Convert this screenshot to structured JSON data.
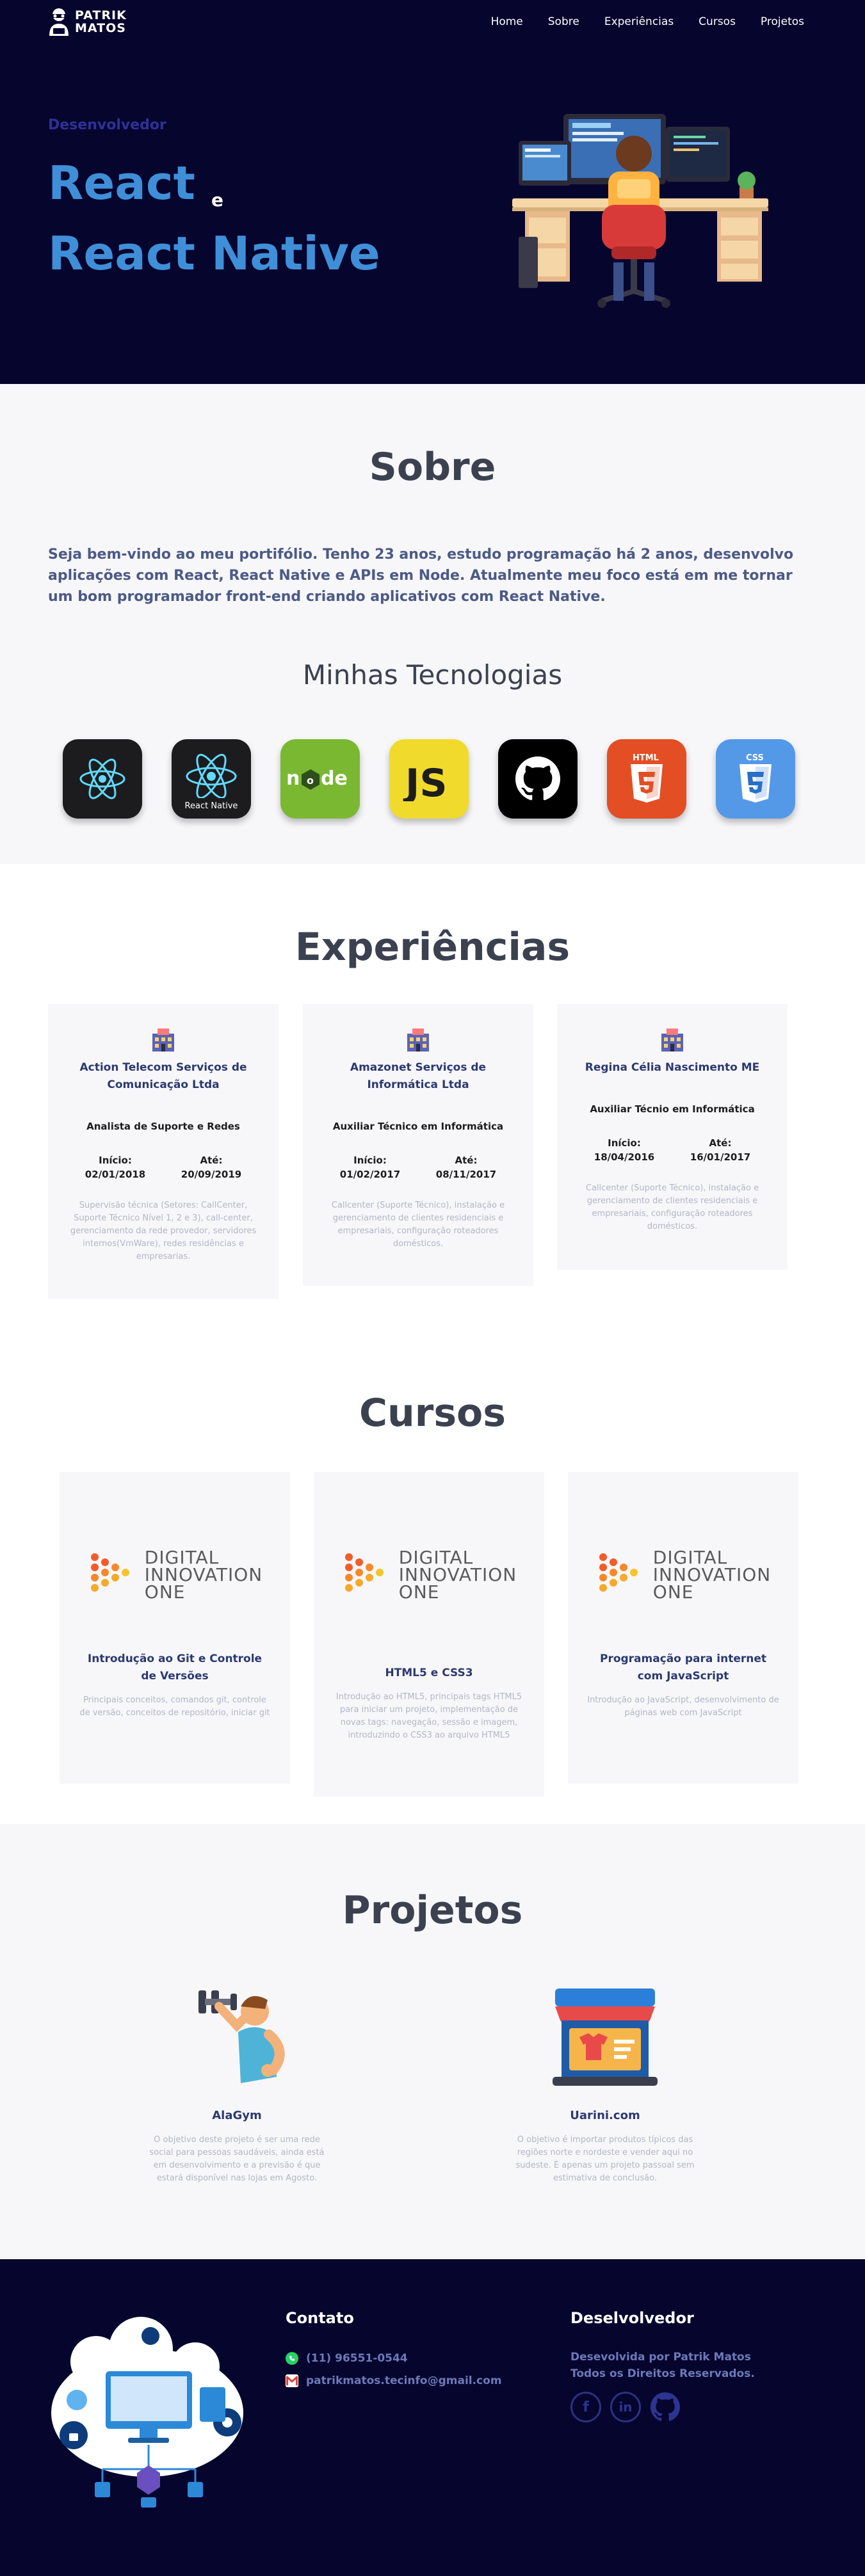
{
  "brand": {
    "line1": "PATRIK",
    "line2": "MATOS"
  },
  "nav": {
    "items": [
      "Home",
      "Sobre",
      "Experiências",
      "Cursos",
      "Projetos"
    ]
  },
  "hero": {
    "subtitle": "Desenvolvedor",
    "title1": "React",
    "connector": "e",
    "title2": "React Native"
  },
  "sobre": {
    "title": "Sobre",
    "text": "Seja bem-vindo ao meu portifólio. Tenho 23 anos, estudo programação há 2 anos, desenvolvo aplicações com React, React Native e APIs em Node. Atualmente meu foco está em me tornar um bom programador front-end criando aplicativos com React Native.",
    "tech_title": "Minhas Tecnologias",
    "techs": [
      {
        "icon": "react-icon",
        "label": "",
        "bg": "#1c1c1f"
      },
      {
        "icon": "react-native-icon",
        "label": "React Native",
        "bg": "#1c1c1f"
      },
      {
        "icon": "node-icon",
        "label": "",
        "bg": "#7ab832"
      },
      {
        "icon": "javascript-icon",
        "label": "",
        "bg": "#f0db2c"
      },
      {
        "icon": "github-icon",
        "label": "",
        "bg": "#000000"
      },
      {
        "icon": "html5-icon",
        "label": "HTML",
        "bg": "#e34e24"
      },
      {
        "icon": "css3-icon",
        "label": "CSS",
        "bg": "#5499e8"
      }
    ]
  },
  "experiencias": {
    "title": "Experiências",
    "start_label": "Início:",
    "end_label": "Até:",
    "items": [
      {
        "company": "Action Telecom Serviços de Comunicação Ltda",
        "role": "Analista de Suporte e Redes",
        "start": "02/01/2018",
        "end": "20/09/2019",
        "desc": "Supervisão técnica (Setores: CallCenter, Suporte Técnico Nível 1, 2 e 3), call-center, gerenciamento da rede provedor, servidores internos(VmWare), redes residências e empresarias."
      },
      {
        "company": "Amazonet Serviços de Informática Ltda",
        "role": "Auxiliar Técnico em Informática",
        "start": "01/02/2017",
        "end": "08/11/2017",
        "desc": "Callcenter (Suporte Técnico), instalação e gerenciamento de clientes residenciais e empresariais, configuração roteadores domésticos."
      },
      {
        "company": "Regina Célia Nascimento ME",
        "role": "Auxiliar Técnio em Informática",
        "start": "18/04/2016",
        "end": "16/01/2017",
        "desc": "Callcenter (Suporte Técnico), instalação e gerenciamento de clientes residenciais e empresariais, configuração roteadores domésticos."
      }
    ]
  },
  "cursos": {
    "title": "Cursos",
    "logo_lines": [
      "DIGITAL",
      "INNOVATION",
      "ONE"
    ],
    "items": [
      {
        "name": "Introdução ao Git e Controle de Versões",
        "desc": "Principais conceitos, comandos git, controle de versão, conceitos de repositório, iniciar git"
      },
      {
        "name": "HTML5 e CSS3",
        "desc": "Introdução ao HTML5, principais tags HTML5 para iniciar um projeto, implementação de novas tags: navegação, sessão e imagem, introduzindo o CSS3 ao arquivo HTML5"
      },
      {
        "name": "Programação para internet com JavaScript",
        "desc": "Introdução ao JavaScript, desenvolvimento de páginas web com JavaScript"
      }
    ]
  },
  "projetos": {
    "title": "Projetos",
    "items": [
      {
        "name": "AlaGym",
        "desc": "O objetivo deste projeto é ser uma rede social para pessoas saudáveis, ainda está em desenvolvimento e a previsão é que estará disponível nas lojas em Agosto."
      },
      {
        "name": "Uarini.com",
        "desc": "O objetivo é importar produtos típicos das regiões norte e nordeste e vender aqui no sudeste. É apenas um projeto passoal sem estimativa de conclusão."
      }
    ]
  },
  "footer": {
    "contact_title": "Contato",
    "phone": "(11) 96551-0544",
    "email": "patrikmatos.tecinfo@gmail.com",
    "dev_title": "Deselvolvedor",
    "dev_line1": "Desevolvida por Patrik Matos",
    "dev_line2": "Todos os Direitos Reservados.",
    "social": [
      "facebook-icon",
      "linkedin-icon",
      "github-icon"
    ]
  },
  "colors": {
    "navy": "#06052e",
    "accent": "#3f8fd8",
    "muted": "#6e79b8",
    "section_bg": "#f7f7fa"
  }
}
